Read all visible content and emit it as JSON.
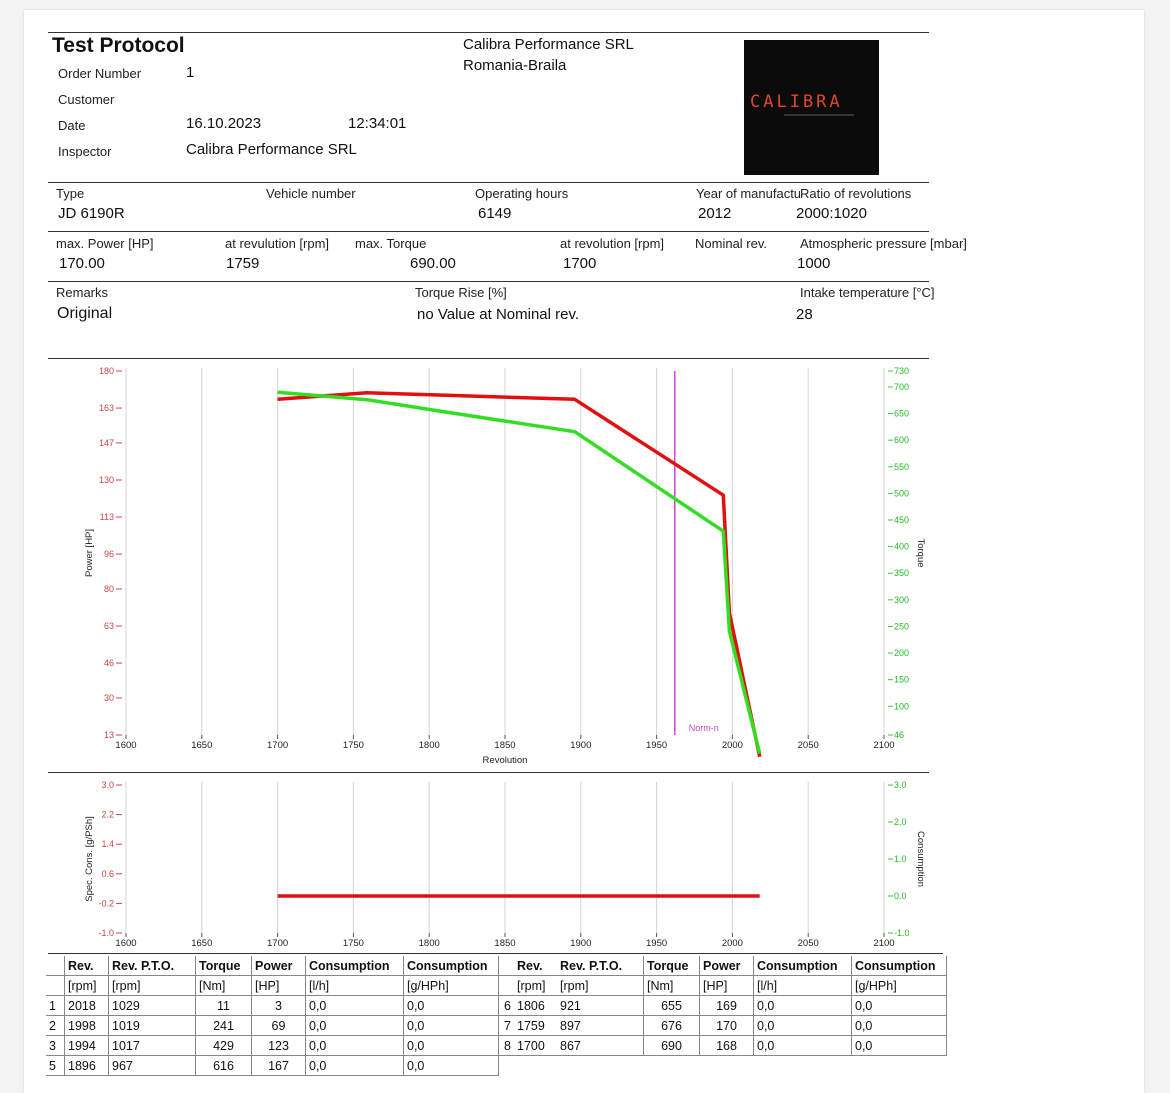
{
  "header": {
    "title": "Test Protocol",
    "company": "Calibra Performance SRL",
    "location": "Romania-Braila",
    "logo_text": "CALIBRA",
    "order_label": "Order Number",
    "order_value": "1",
    "customer_label": "Customer",
    "date_label": "Date",
    "date_value": "16.10.2023",
    "time_value": "12:34:01",
    "inspector_label": "Inspector",
    "inspector_value": "Calibra Performance SRL"
  },
  "vehicle": {
    "type_label": "Type",
    "type_value": "JD 6190R",
    "vehicle_number_label": "Vehicle number",
    "hours_label": "Operating hours",
    "hours_value": "6149",
    "year_label": "Year of manufactur",
    "year_value": "2012",
    "ratio_label": "Ratio of revolutions",
    "ratio_value": "2000:1020"
  },
  "performance": {
    "max_power_label": "max. Power [HP]",
    "max_power_value": "170.00",
    "at_rev1_label": "at revulution [rpm]",
    "at_rev1_value": "1759",
    "max_torque_label": "max. Torque",
    "max_torque_value": "690.00",
    "at_rev2_label": "at revolution [rpm]",
    "at_rev2_value": "1700",
    "nominal_label": "Nominal rev.",
    "pressure_label": "Atmospheric pressure [mbar]",
    "pressure_value": "1000"
  },
  "remarks": {
    "remarks_label": "Remarks",
    "remarks_value": "Original",
    "torque_rise_label": "Torque Rise [%]",
    "torque_rise_value": "no Value at Nominal rev.",
    "intake_label": "Intake temperature [°C]",
    "intake_value": "28"
  },
  "chart_data": [
    {
      "type": "line",
      "xlabel": "Revolution",
      "ylabel": "Power [HP]",
      "y2label": "Torque",
      "xlim": [
        1600,
        2100
      ],
      "ylim": [
        13,
        180
      ],
      "y2lim": [
        46,
        730
      ],
      "x_ticks": [
        "1600",
        "1650",
        "1700",
        "1750",
        "1800",
        "1850",
        "1900",
        "1950",
        "2000",
        "2050",
        "2100"
      ],
      "y_ticks": [
        "180",
        "163",
        "147",
        "130",
        "113",
        "96",
        "80",
        "63",
        "46",
        "30",
        "13"
      ],
      "y2_ticks": [
        "730",
        "700",
        "650",
        "600",
        "550",
        "500",
        "450",
        "400",
        "350",
        "300",
        "250",
        "200",
        "150",
        "100",
        "46"
      ],
      "series": [
        {
          "color": "#e01010",
          "axis": "left",
          "x": [
            1700,
            1759,
            1806,
            1896,
            1994,
            1998,
            2018
          ],
          "y": [
            167,
            170,
            169,
            167,
            123,
            69,
            3
          ]
        },
        {
          "color": "#33dd22",
          "axis": "right",
          "x": [
            1700,
            1759,
            1806,
            1896,
            1994,
            1998,
            2018
          ],
          "y": [
            690,
            676,
            655,
            616,
            429,
            241,
            11
          ]
        }
      ],
      "vline": {
        "x": 1962,
        "label": "Norm-n",
        "color": "#cc44cc"
      },
      "grid": true
    },
    {
      "type": "line",
      "ylabel": "Spec. Cons. [g/PSh]",
      "y2label": "Consumption",
      "xlim": [
        1600,
        2100
      ],
      "ylim": [
        -1.0,
        3.0
      ],
      "y2lim": [
        -1.0,
        3.0
      ],
      "x_ticks": [
        "1600",
        "1650",
        "1700",
        "1750",
        "1800",
        "1850",
        "1900",
        "1950",
        "2000",
        "2050",
        "2100"
      ],
      "y_ticks": [
        "3.0",
        "2.2",
        "1.4",
        "0.6",
        "-0.2",
        "-1.0"
      ],
      "y2_ticks": [
        "3.0",
        "2.0",
        "1.0",
        "0.0",
        "-1.0"
      ],
      "series": [
        {
          "color": "#e01010",
          "x": [
            1700,
            2018
          ],
          "y": [
            0.0,
            0.0
          ]
        }
      ],
      "grid": true
    }
  ],
  "table": {
    "headers1": [
      "Rev.",
      "Rev. P.T.O.",
      "Torque",
      "Power",
      "Consumption",
      "Consumption"
    ],
    "headers2": [
      "[rpm]",
      "[rpm]",
      "[Nm]",
      "[HP]",
      "[l/h]",
      "[g/HPh]"
    ],
    "left_rows": [
      [
        "1",
        "2018",
        "1029",
        "11",
        "3",
        "0,0",
        "0,0"
      ],
      [
        "2",
        "1998",
        "1019",
        "241",
        "69",
        "0,0",
        "0,0"
      ],
      [
        "3",
        "1994",
        "1017",
        "429",
        "123",
        "0,0",
        "0,0"
      ],
      [
        "5",
        "1896",
        "967",
        "616",
        "167",
        "0,0",
        "0,0"
      ]
    ],
    "right_rows": [
      [
        "6",
        "1806",
        "921",
        "655",
        "169",
        "0,0",
        "0,0"
      ],
      [
        "7",
        "1759",
        "897",
        "676",
        "170",
        "0,0",
        "0,0"
      ],
      [
        "8",
        "1700",
        "867",
        "690",
        "168",
        "0,0",
        "0,0"
      ]
    ]
  }
}
